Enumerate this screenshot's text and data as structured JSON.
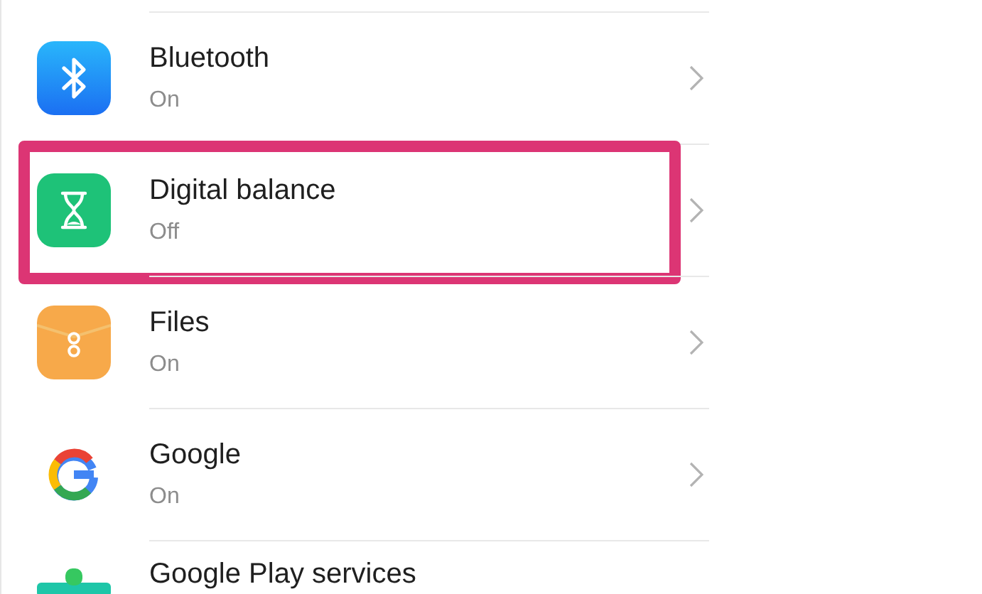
{
  "settings_list": [
    {
      "kind": "bluetooth",
      "title": "Bluetooth",
      "status": "On",
      "highlighted": false
    },
    {
      "kind": "hourglass",
      "title": "Digital balance",
      "status": "Off",
      "highlighted": true
    },
    {
      "kind": "files",
      "title": "Files",
      "status": "On",
      "highlighted": false
    },
    {
      "kind": "google",
      "title": "Google",
      "status": "On",
      "highlighted": false
    },
    {
      "kind": "play",
      "title": "Google Play services",
      "highlighted": false
    }
  ]
}
